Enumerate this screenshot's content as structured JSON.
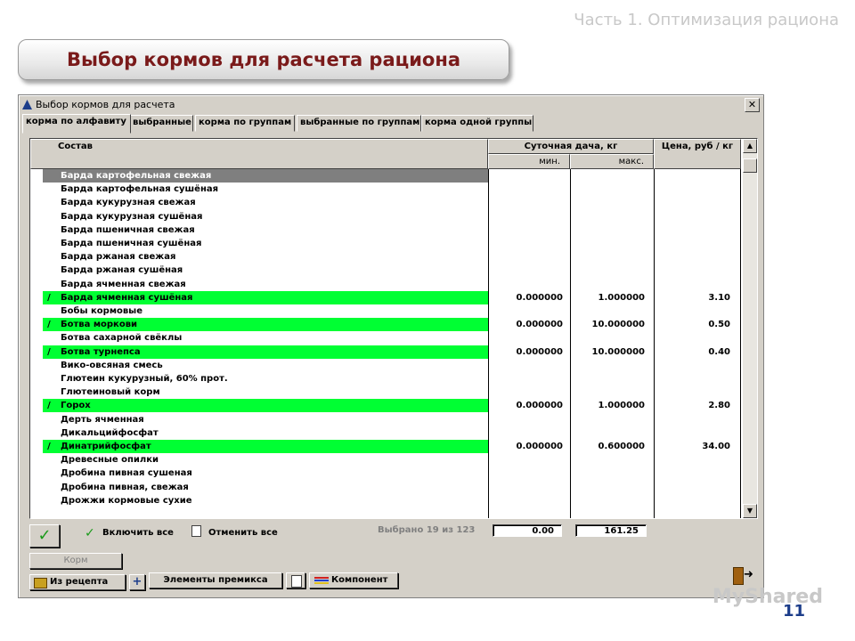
{
  "slide": {
    "part_title": "Часть 1. Оптимизация рациона",
    "main_title": "Выбор кормов для расчета рациона",
    "page_number": "11",
    "watermark": "MyShared"
  },
  "window": {
    "title": "Выбор кормов для расчета",
    "close_label": "✕"
  },
  "tabs": [
    {
      "label": "корма по алфавиту",
      "active": true
    },
    {
      "label": "выбранные",
      "active": false
    },
    {
      "label": "корма по группам",
      "active": false
    },
    {
      "label": "выбранные по группам",
      "active": false
    },
    {
      "label": "корма одной группы",
      "active": false
    }
  ],
  "grid": {
    "col_name": "Состав",
    "col_daily": "Суточная дача, кг",
    "col_min": "мин.",
    "col_max": "макс.",
    "col_price": "Цена, руб / кг",
    "rows": [
      {
        "name": "Барда картофельная свежая",
        "selected_cursor": true,
        "checked": false,
        "min": "",
        "max": "",
        "price": ""
      },
      {
        "name": "Барда картофельная сушёная",
        "checked": false,
        "min": "",
        "max": "",
        "price": ""
      },
      {
        "name": "Барда кукурузная свежая",
        "checked": false,
        "min": "",
        "max": "",
        "price": ""
      },
      {
        "name": "Барда кукурузная сушёная",
        "checked": false,
        "min": "",
        "max": "",
        "price": ""
      },
      {
        "name": "Барда пшеничная свежая",
        "checked": false,
        "min": "",
        "max": "",
        "price": ""
      },
      {
        "name": "Барда пшеничная сушёная",
        "checked": false,
        "min": "",
        "max": "",
        "price": ""
      },
      {
        "name": "Барда ржаная свежая",
        "checked": false,
        "min": "",
        "max": "",
        "price": ""
      },
      {
        "name": "Барда ржаная сушёная",
        "checked": false,
        "min": "",
        "max": "",
        "price": ""
      },
      {
        "name": "Барда ячменная свежая",
        "checked": false,
        "min": "",
        "max": "",
        "price": ""
      },
      {
        "name": "Барда ячменная сушёная",
        "checked": true,
        "min": "0.000000",
        "max": "1.000000",
        "price": "3.10"
      },
      {
        "name": "Бобы кормовые",
        "checked": false,
        "min": "",
        "max": "",
        "price": ""
      },
      {
        "name": "Ботва моркови",
        "checked": true,
        "min": "0.000000",
        "max": "10.000000",
        "price": "0.50"
      },
      {
        "name": "Ботва сахарной свёклы",
        "checked": false,
        "min": "",
        "max": "",
        "price": ""
      },
      {
        "name": "Ботва турнепса",
        "checked": true,
        "min": "0.000000",
        "max": "10.000000",
        "price": "0.40"
      },
      {
        "name": "Вико-овсяная смесь",
        "checked": false,
        "min": "",
        "max": "",
        "price": ""
      },
      {
        "name": "Глютеин кукурузный, 60% прот.",
        "checked": false,
        "min": "",
        "max": "",
        "price": ""
      },
      {
        "name": "Глютеиновый корм",
        "checked": false,
        "min": "",
        "max": "",
        "price": ""
      },
      {
        "name": "Горох",
        "checked": true,
        "min": "0.000000",
        "max": "1.000000",
        "price": "2.80"
      },
      {
        "name": "Дерть ячменная",
        "checked": false,
        "min": "",
        "max": "",
        "price": ""
      },
      {
        "name": "Дикальцийфосфат",
        "checked": false,
        "min": "",
        "max": "",
        "price": ""
      },
      {
        "name": "Динатрийфосфат",
        "checked": true,
        "min": "0.000000",
        "max": "0.600000",
        "price": "34.00"
      },
      {
        "name": "Древесные опилки",
        "checked": false,
        "min": "",
        "max": "",
        "price": ""
      },
      {
        "name": "Дробина пивная сушеная",
        "checked": false,
        "min": "",
        "max": "",
        "price": ""
      },
      {
        "name": "Дробина пивная, свежая",
        "checked": false,
        "min": "",
        "max": "",
        "price": ""
      },
      {
        "name": "Дрожжи кормовые сухие",
        "checked": false,
        "min": "",
        "max": "",
        "price": ""
      }
    ]
  },
  "footer": {
    "ok_label": "✓",
    "include_all_label": "Включить все",
    "cancel_all_label": "Отменить все",
    "selected_count_text": "Выбрано 19 из 123",
    "total_min": "0.00",
    "total_max": "161.25",
    "feed_label": "Корм",
    "from_recipe_label": "Из рецепта",
    "plus_label": "+",
    "premix_label": "Элементы премикса",
    "component_label": "Компонент",
    "exit_icon": "exit-door-icon"
  },
  "colors": {
    "highlight": "#00ff33",
    "selection": "#808080",
    "window_bg": "#d4d0c8",
    "title_text": "#7a1a1a",
    "page_number": "#1c3d8a"
  }
}
